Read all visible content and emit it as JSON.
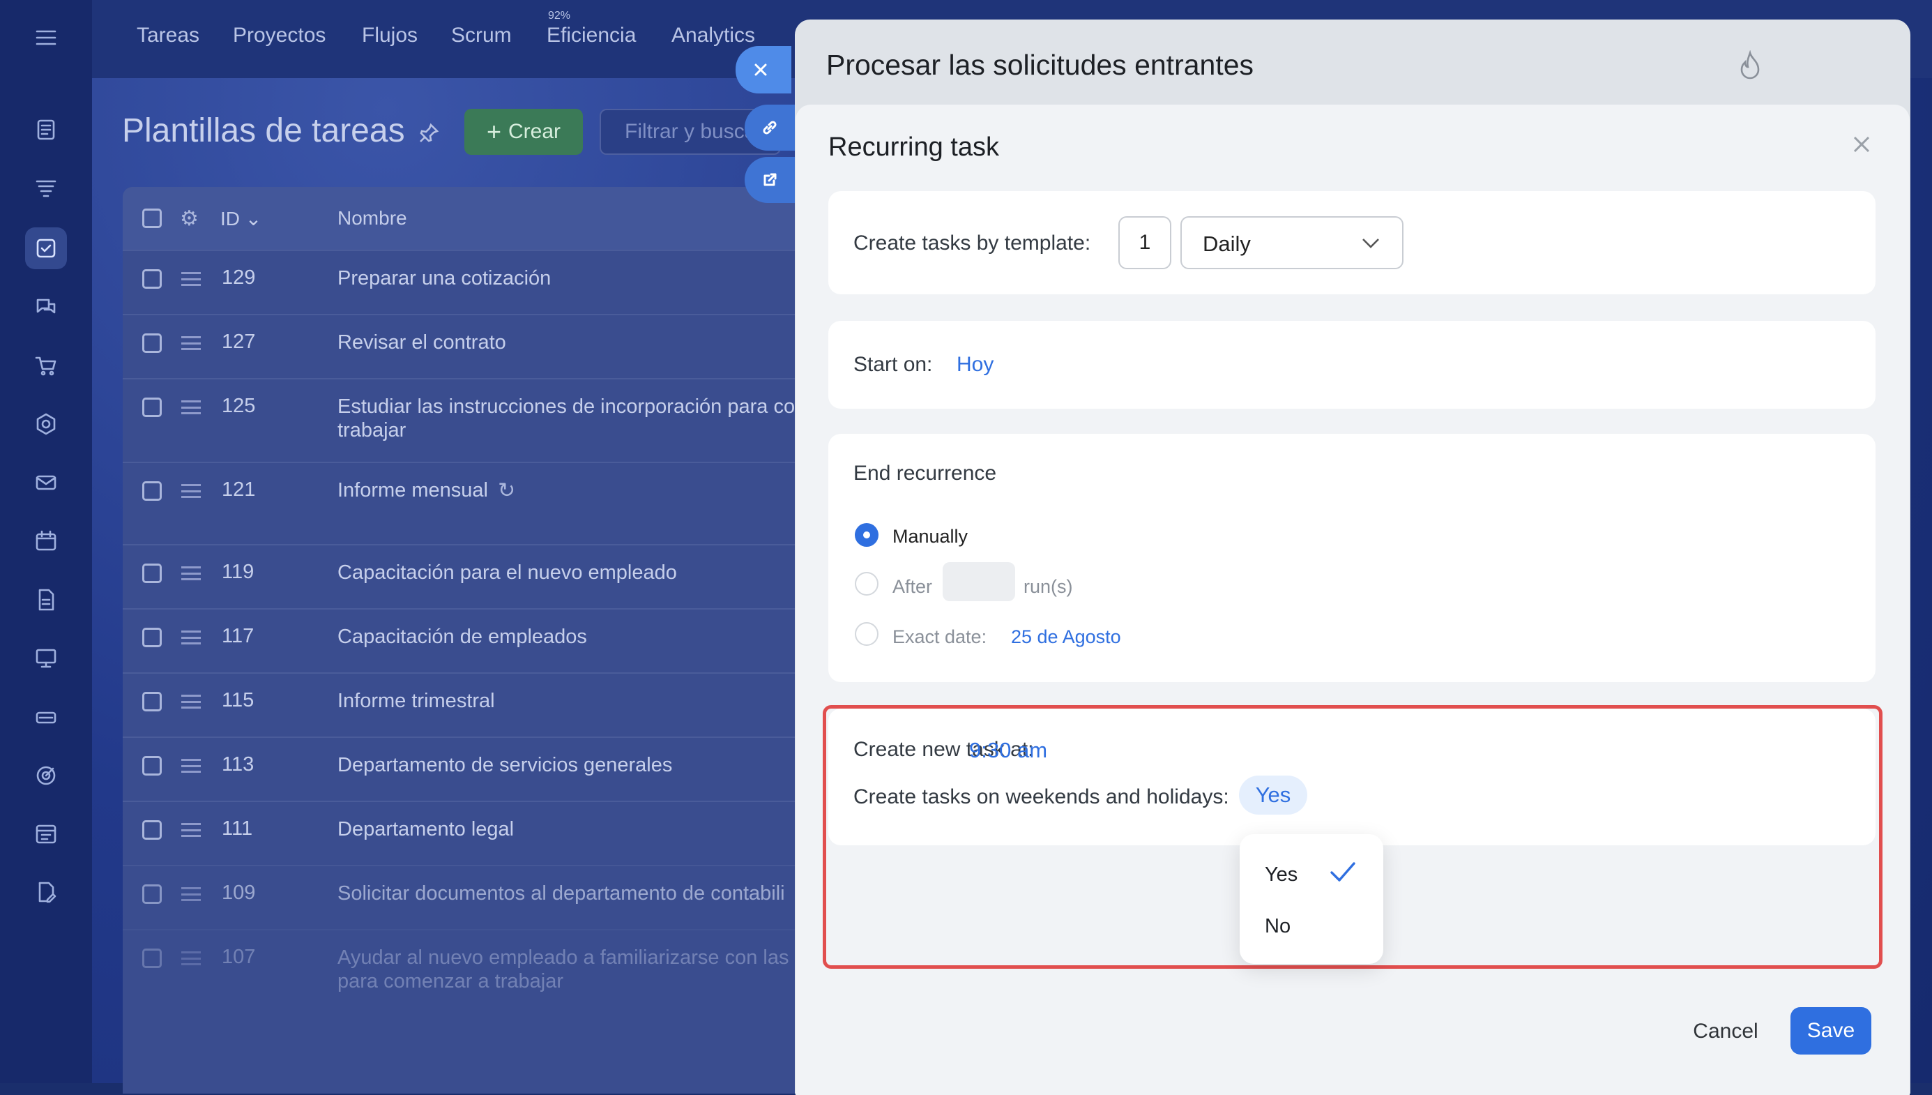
{
  "nav": {
    "items": [
      "Tareas",
      "Proyectos",
      "Flujos",
      "Scrum",
      "Eficiencia",
      "Analytics"
    ],
    "efficiency_badge": "92%"
  },
  "page": {
    "title": "Plantillas de tareas",
    "create_label": "Crear",
    "filter_placeholder": "Filtrar y buscar"
  },
  "table": {
    "col_id": "ID",
    "col_name": "Nombre",
    "rows": [
      {
        "id": "129",
        "name": "Preparar una cotización"
      },
      {
        "id": "127",
        "name": "Revisar el contrato"
      },
      {
        "id": "125",
        "name": "Estudiar las instrucciones de incorporación para co trabajar"
      },
      {
        "id": "121",
        "name": "Informe mensual"
      },
      {
        "id": "119",
        "name": "Capacitación para el nuevo empleado"
      },
      {
        "id": "117",
        "name": "Capacitación de empleados"
      },
      {
        "id": "115",
        "name": "Informe trimestral"
      },
      {
        "id": "113",
        "name": "Departamento de servicios generales"
      },
      {
        "id": "111",
        "name": "Departamento legal"
      },
      {
        "id": "109",
        "name": "Solicitar documentos al departamento de contabili"
      },
      {
        "id": "107",
        "name": "Ayudar al nuevo empleado a familiarizarse con las para comenzar a trabajar"
      }
    ]
  },
  "slider": {
    "title": "Procesar las solicitudes entrantes"
  },
  "modal": {
    "title": "Recurring task",
    "template_label": "Create tasks by template:",
    "interval_value": "1",
    "frequency_value": "Daily",
    "start_label": "Start on:",
    "start_value": "Hoy",
    "end_title": "End recurrence",
    "end_manual": "Manually",
    "end_after": "After",
    "end_runs_suffix": "run(s)",
    "end_exact": "Exact date:",
    "end_exact_value": "25 de Agosto",
    "time_label": "Create new task at:",
    "time_value": "9:30 am",
    "weekend_label": "Create tasks on weekends and holidays:",
    "weekend_value": "Yes",
    "dropdown_options": [
      "Yes",
      "No"
    ],
    "cancel_label": "Cancel",
    "save_label": "Save"
  },
  "colors": {
    "accent": "#2f6fe0",
    "highlight_border": "#e14e4e",
    "create_button": "#3b7a57"
  }
}
